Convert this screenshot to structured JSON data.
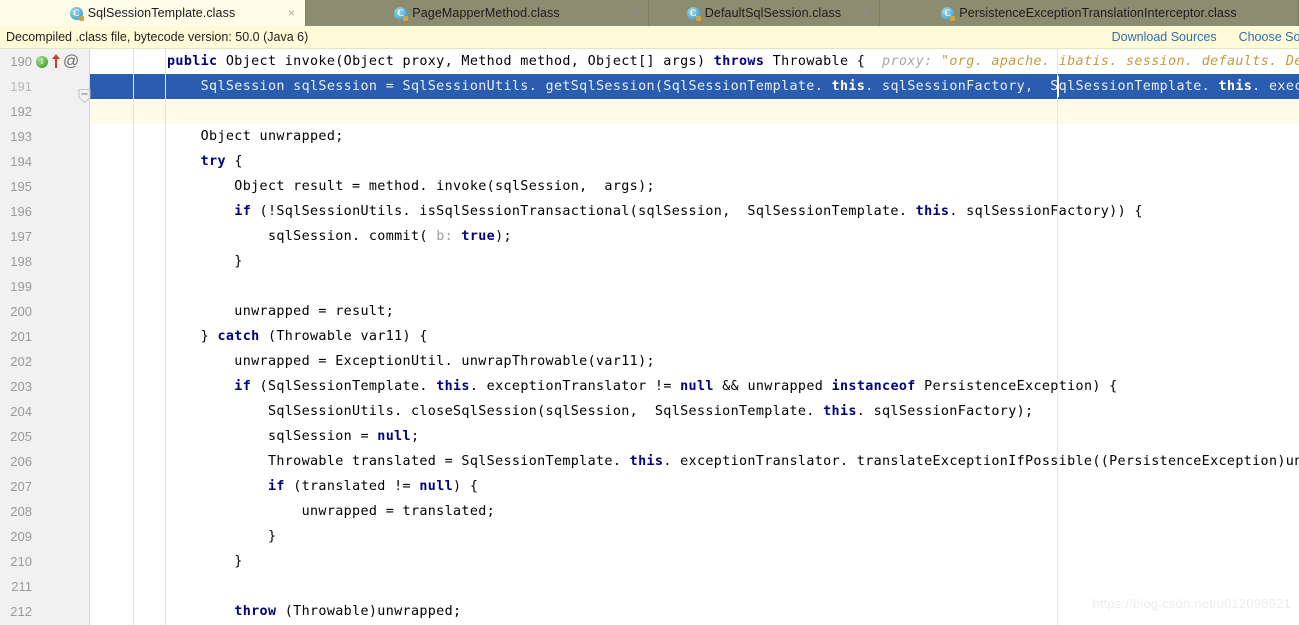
{
  "tabs": [
    {
      "label": "SqlSessionTemplate.class",
      "icon": "java-class-icon",
      "active": true,
      "close": "×"
    },
    {
      "label": "PageMapperMethod.class",
      "icon": "java-class-icon",
      "active": false,
      "close": "×"
    },
    {
      "label": "DefaultSqlSession.class",
      "icon": "java-class-icon",
      "active": false,
      "close": "×"
    },
    {
      "label": "PersistenceExceptionTranslationInterceptor.class",
      "icon": "java-class-icon",
      "active": false,
      "close": "×"
    }
  ],
  "notification": {
    "message": "Decompiled .class file, bytecode version: 50.0 (Java 6)",
    "download_sources": "Download Sources",
    "choose_sources": "Choose Sources"
  },
  "gutter": {
    "implementing_method_icon": "I",
    "override_arrow_icon": "override-arrow",
    "annotation_icon": "@",
    "fold_icon": "fold-collapse"
  },
  "editor": {
    "watermark": "https://blog.csdn.net/u012098021",
    "lines": [
      {
        "num": "190",
        "state": "normal"
      },
      {
        "num": "191",
        "state": "selected"
      },
      {
        "num": "192",
        "state": "caret"
      },
      {
        "num": "193",
        "state": "normal"
      },
      {
        "num": "194",
        "state": "normal"
      },
      {
        "num": "195",
        "state": "normal"
      },
      {
        "num": "196",
        "state": "normal"
      },
      {
        "num": "197",
        "state": "normal"
      },
      {
        "num": "198",
        "state": "normal"
      },
      {
        "num": "199",
        "state": "normal"
      },
      {
        "num": "200",
        "state": "normal"
      },
      {
        "num": "201",
        "state": "normal"
      },
      {
        "num": "202",
        "state": "normal"
      },
      {
        "num": "203",
        "state": "normal"
      },
      {
        "num": "204",
        "state": "normal"
      },
      {
        "num": "205",
        "state": "normal"
      },
      {
        "num": "206",
        "state": "normal"
      },
      {
        "num": "207",
        "state": "normal"
      },
      {
        "num": "208",
        "state": "normal"
      },
      {
        "num": "209",
        "state": "normal"
      },
      {
        "num": "210",
        "state": "normal"
      },
      {
        "num": "211",
        "state": "normal"
      },
      {
        "num": "212",
        "state": "normal"
      }
    ],
    "code": {
      "l190_a": "public ",
      "l190_b": "Object invoke(Object proxy, Method method, Object[] args) ",
      "l190_c": "throws",
      "l190_d": " Throwable {",
      "l190_hint_label": "proxy:",
      "l190_hint_value": "\"org. apache. ibatis. session. defaults. DefaultSqlSes",
      "l191_a": "    SqlSession sqlSession = SqlSessionUtils. getSqlSession(SqlSessionTemplate. ",
      "l191_this1": "this",
      "l191_b": ". sqlSessionFactory,  SqlSessionTemplate. ",
      "l191_this2": "this",
      "l191_c": ". executorType,  Sq",
      "l193": "    Object unwrapped;",
      "l194_kw": "try",
      "l194_rest": " {",
      "l195": "        Object result = method. invoke(sqlSession,  args);",
      "l196_kw": "if",
      "l196_a": " (!SqlSessionUtils. isSqlSessionTransactional(sqlSession,  SqlSessionTemplate. ",
      "l196_this": "this",
      "l196_b": ". sqlSessionFactory)) {",
      "l197_a": "            sqlSession. commit( ",
      "l197_hint": "b:",
      "l197_kw": " true",
      "l197_b": ");",
      "l198": "        }",
      "l200": "        unwrapped = result;",
      "l201_a": "    } ",
      "l201_kw": "catch",
      "l201_b": " (Throwable var11) {",
      "l202": "        unwrapped = ExceptionUtil. unwrapThrowable(var11);",
      "l203_kw": "if",
      "l203_a": " (SqlSessionTemplate. ",
      "l203_this": "this",
      "l203_b": ". exceptionTranslator != ",
      "l203_null": "null",
      "l203_c": " && unwrapped ",
      "l203_instanceof": "instanceof",
      "l203_d": " PersistenceException) {",
      "l204_a": "            SqlSessionUtils. closeSqlSession(sqlSession,  SqlSessionTemplate. ",
      "l204_this": "this",
      "l204_b": ". sqlSessionFactory);",
      "l205_a": "            sqlSession = ",
      "l205_null": "null",
      "l205_b": ";",
      "l206_a": "            Throwable translated = SqlSessionTemplate. ",
      "l206_this": "this",
      "l206_b": ". exceptionTranslator. translateExceptionIfPossible((PersistenceException)unwrapped);",
      "l207_kw": "if",
      "l207_a": " (translated != ",
      "l207_null": "null",
      "l207_b": ") {",
      "l208": "                unwrapped = translated;",
      "l209": "            }",
      "l210": "        }",
      "l212_kw": "throw",
      "l212_rest": " (Throwable)unwrapped;"
    }
  }
}
